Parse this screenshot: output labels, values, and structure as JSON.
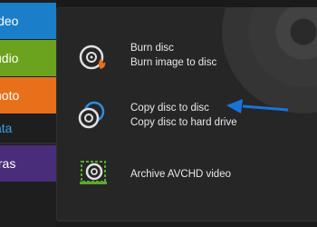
{
  "sidebar": {
    "tabs": [
      {
        "label": "ideo"
      },
      {
        "label": "udio"
      },
      {
        "label": "hoto"
      },
      {
        "label": "ata"
      },
      {
        "label": "tras"
      }
    ]
  },
  "actions": {
    "burn_disc": "Burn disc",
    "burn_image": "Burn image to disc",
    "copy_disc": "Copy disc to disc",
    "copy_hdd": "Copy disc to hard drive",
    "archive_avchd": "Archive AVCHD video"
  },
  "colors": {
    "video": "#1a7ec8",
    "audio": "#6ba31e",
    "photo": "#e8701a",
    "data_text": "#3ba0ea",
    "extras": "#4a2d7a",
    "arrow": "#1a73d9"
  }
}
